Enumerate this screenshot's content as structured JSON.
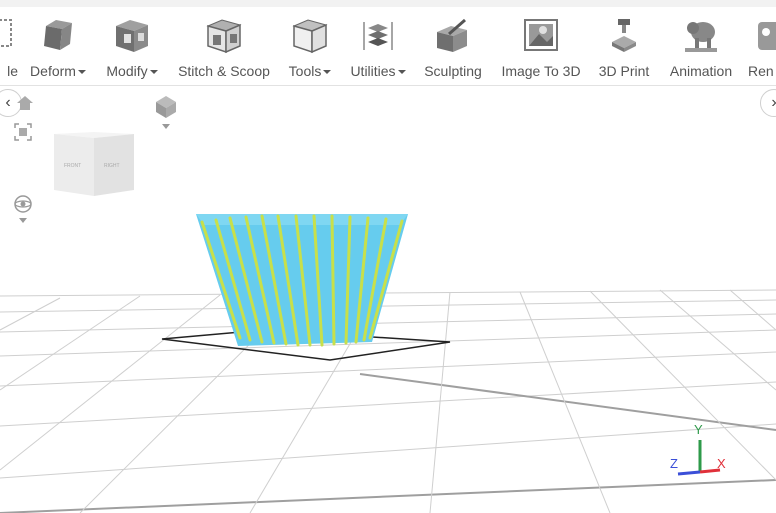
{
  "toolbar": {
    "items": [
      {
        "label": "le",
        "icon": "dashed-box-icon",
        "dropdown": false
      },
      {
        "label": "Deform",
        "icon": "deform-box-icon",
        "dropdown": true
      },
      {
        "label": "Modify",
        "icon": "modify-box-icon",
        "dropdown": true
      },
      {
        "label": "Stitch & Scoop",
        "icon": "stitch-scoop-icon",
        "dropdown": false
      },
      {
        "label": "Tools",
        "icon": "tools-icon",
        "dropdown": true
      },
      {
        "label": "Utilities",
        "icon": "utilities-icon",
        "dropdown": true
      },
      {
        "label": "Sculpting",
        "icon": "sculpting-icon",
        "dropdown": false
      },
      {
        "label": "Image To 3D",
        "icon": "image-to-3d-icon",
        "dropdown": false
      },
      {
        "label": "3D Print",
        "icon": "3d-print-icon",
        "dropdown": false
      },
      {
        "label": "Animation",
        "icon": "animation-icon",
        "dropdown": false
      },
      {
        "label": "Ren",
        "icon": "render-icon",
        "dropdown": false
      }
    ]
  },
  "view_cube": {
    "front_label": "FRONT",
    "right_label": "RIGHT"
  },
  "axes": {
    "x_label": "X",
    "y_label": "Y",
    "z_label": "Z",
    "x_color": "#e0303a",
    "y_color": "#2e9a4a",
    "z_color": "#3b4fd8"
  },
  "model": {
    "fill_color": "#66ccee",
    "stripe_color": "#c8e04a"
  }
}
